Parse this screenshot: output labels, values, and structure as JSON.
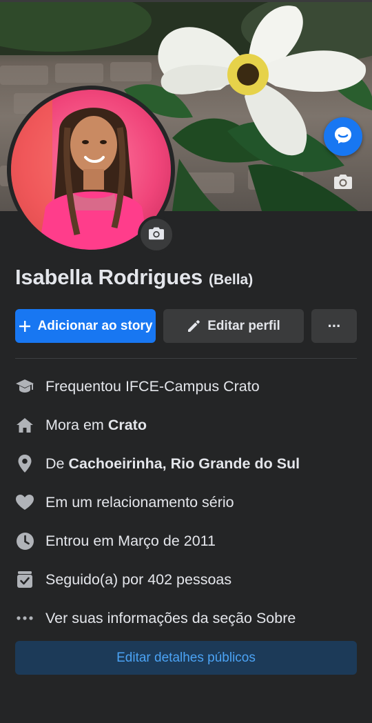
{
  "profile": {
    "name": "Isabella Rodrigues",
    "nickname": "(Bella)"
  },
  "actions": {
    "add_story": "Adicionar ao story",
    "edit_profile": "Editar perfil",
    "more": "···"
  },
  "details": {
    "education": "Frequentou IFCE-Campus Crato",
    "lives_prefix": "Mora em ",
    "lives_city": "Crato",
    "from_prefix": "De ",
    "from_place": "Cachoeirinha, Rio Grande do Sul",
    "relationship": "Em um relacionamento sério",
    "joined": "Entrou em Março de 2011",
    "followers": "Seguido(a) por 402 pessoas",
    "about": "Ver suas informações da seção Sobre"
  },
  "edit_public_label": "Editar detalhes públicos",
  "icons": {
    "cover_camera": "camera-icon",
    "avatar_camera": "camera-icon",
    "messenger": "messenger-icon",
    "plus": "plus-icon",
    "pencil": "pencil-icon",
    "education": "graduation-cap-icon",
    "home": "home-icon",
    "location": "location-pin-icon",
    "relationship": "heart-icon",
    "joined": "clock-icon",
    "followers": "inbox-check-icon",
    "about": "ellipsis-icon"
  },
  "colors": {
    "background": "#242526",
    "primary": "#1877f2",
    "secondary_button": "#3a3b3c",
    "text": "#e4e6eb",
    "edit_public_bg": "#1c3a58",
    "edit_public_text": "#4ba3f5"
  }
}
